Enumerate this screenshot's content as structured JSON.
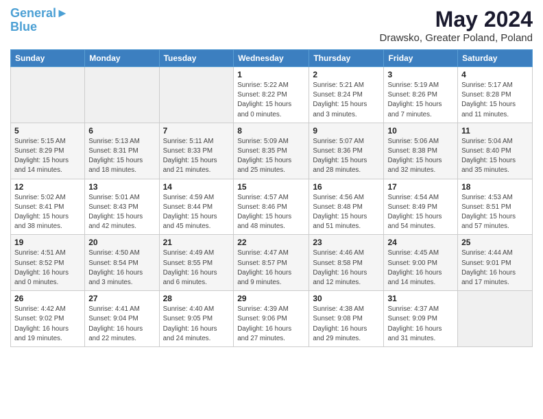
{
  "header": {
    "logo_line1": "General",
    "logo_line2": "Blue",
    "title": "May 2024",
    "subtitle": "Drawsko, Greater Poland, Poland"
  },
  "days_of_week": [
    "Sunday",
    "Monday",
    "Tuesday",
    "Wednesday",
    "Thursday",
    "Friday",
    "Saturday"
  ],
  "weeks": [
    [
      {
        "day": "",
        "info": ""
      },
      {
        "day": "",
        "info": ""
      },
      {
        "day": "",
        "info": ""
      },
      {
        "day": "1",
        "info": "Sunrise: 5:22 AM\nSunset: 8:22 PM\nDaylight: 15 hours\nand 0 minutes."
      },
      {
        "day": "2",
        "info": "Sunrise: 5:21 AM\nSunset: 8:24 PM\nDaylight: 15 hours\nand 3 minutes."
      },
      {
        "day": "3",
        "info": "Sunrise: 5:19 AM\nSunset: 8:26 PM\nDaylight: 15 hours\nand 7 minutes."
      },
      {
        "day": "4",
        "info": "Sunrise: 5:17 AM\nSunset: 8:28 PM\nDaylight: 15 hours\nand 11 minutes."
      }
    ],
    [
      {
        "day": "5",
        "info": "Sunrise: 5:15 AM\nSunset: 8:29 PM\nDaylight: 15 hours\nand 14 minutes."
      },
      {
        "day": "6",
        "info": "Sunrise: 5:13 AM\nSunset: 8:31 PM\nDaylight: 15 hours\nand 18 minutes."
      },
      {
        "day": "7",
        "info": "Sunrise: 5:11 AM\nSunset: 8:33 PM\nDaylight: 15 hours\nand 21 minutes."
      },
      {
        "day": "8",
        "info": "Sunrise: 5:09 AM\nSunset: 8:35 PM\nDaylight: 15 hours\nand 25 minutes."
      },
      {
        "day": "9",
        "info": "Sunrise: 5:07 AM\nSunset: 8:36 PM\nDaylight: 15 hours\nand 28 minutes."
      },
      {
        "day": "10",
        "info": "Sunrise: 5:06 AM\nSunset: 8:38 PM\nDaylight: 15 hours\nand 32 minutes."
      },
      {
        "day": "11",
        "info": "Sunrise: 5:04 AM\nSunset: 8:40 PM\nDaylight: 15 hours\nand 35 minutes."
      }
    ],
    [
      {
        "day": "12",
        "info": "Sunrise: 5:02 AM\nSunset: 8:41 PM\nDaylight: 15 hours\nand 38 minutes."
      },
      {
        "day": "13",
        "info": "Sunrise: 5:01 AM\nSunset: 8:43 PM\nDaylight: 15 hours\nand 42 minutes."
      },
      {
        "day": "14",
        "info": "Sunrise: 4:59 AM\nSunset: 8:44 PM\nDaylight: 15 hours\nand 45 minutes."
      },
      {
        "day": "15",
        "info": "Sunrise: 4:57 AM\nSunset: 8:46 PM\nDaylight: 15 hours\nand 48 minutes."
      },
      {
        "day": "16",
        "info": "Sunrise: 4:56 AM\nSunset: 8:48 PM\nDaylight: 15 hours\nand 51 minutes."
      },
      {
        "day": "17",
        "info": "Sunrise: 4:54 AM\nSunset: 8:49 PM\nDaylight: 15 hours\nand 54 minutes."
      },
      {
        "day": "18",
        "info": "Sunrise: 4:53 AM\nSunset: 8:51 PM\nDaylight: 15 hours\nand 57 minutes."
      }
    ],
    [
      {
        "day": "19",
        "info": "Sunrise: 4:51 AM\nSunset: 8:52 PM\nDaylight: 16 hours\nand 0 minutes."
      },
      {
        "day": "20",
        "info": "Sunrise: 4:50 AM\nSunset: 8:54 PM\nDaylight: 16 hours\nand 3 minutes."
      },
      {
        "day": "21",
        "info": "Sunrise: 4:49 AM\nSunset: 8:55 PM\nDaylight: 16 hours\nand 6 minutes."
      },
      {
        "day": "22",
        "info": "Sunrise: 4:47 AM\nSunset: 8:57 PM\nDaylight: 16 hours\nand 9 minutes."
      },
      {
        "day": "23",
        "info": "Sunrise: 4:46 AM\nSunset: 8:58 PM\nDaylight: 16 hours\nand 12 minutes."
      },
      {
        "day": "24",
        "info": "Sunrise: 4:45 AM\nSunset: 9:00 PM\nDaylight: 16 hours\nand 14 minutes."
      },
      {
        "day": "25",
        "info": "Sunrise: 4:44 AM\nSunset: 9:01 PM\nDaylight: 16 hours\nand 17 minutes."
      }
    ],
    [
      {
        "day": "26",
        "info": "Sunrise: 4:42 AM\nSunset: 9:02 PM\nDaylight: 16 hours\nand 19 minutes."
      },
      {
        "day": "27",
        "info": "Sunrise: 4:41 AM\nSunset: 9:04 PM\nDaylight: 16 hours\nand 22 minutes."
      },
      {
        "day": "28",
        "info": "Sunrise: 4:40 AM\nSunset: 9:05 PM\nDaylight: 16 hours\nand 24 minutes."
      },
      {
        "day": "29",
        "info": "Sunrise: 4:39 AM\nSunset: 9:06 PM\nDaylight: 16 hours\nand 27 minutes."
      },
      {
        "day": "30",
        "info": "Sunrise: 4:38 AM\nSunset: 9:08 PM\nDaylight: 16 hours\nand 29 minutes."
      },
      {
        "day": "31",
        "info": "Sunrise: 4:37 AM\nSunset: 9:09 PM\nDaylight: 16 hours\nand 31 minutes."
      },
      {
        "day": "",
        "info": ""
      }
    ]
  ]
}
